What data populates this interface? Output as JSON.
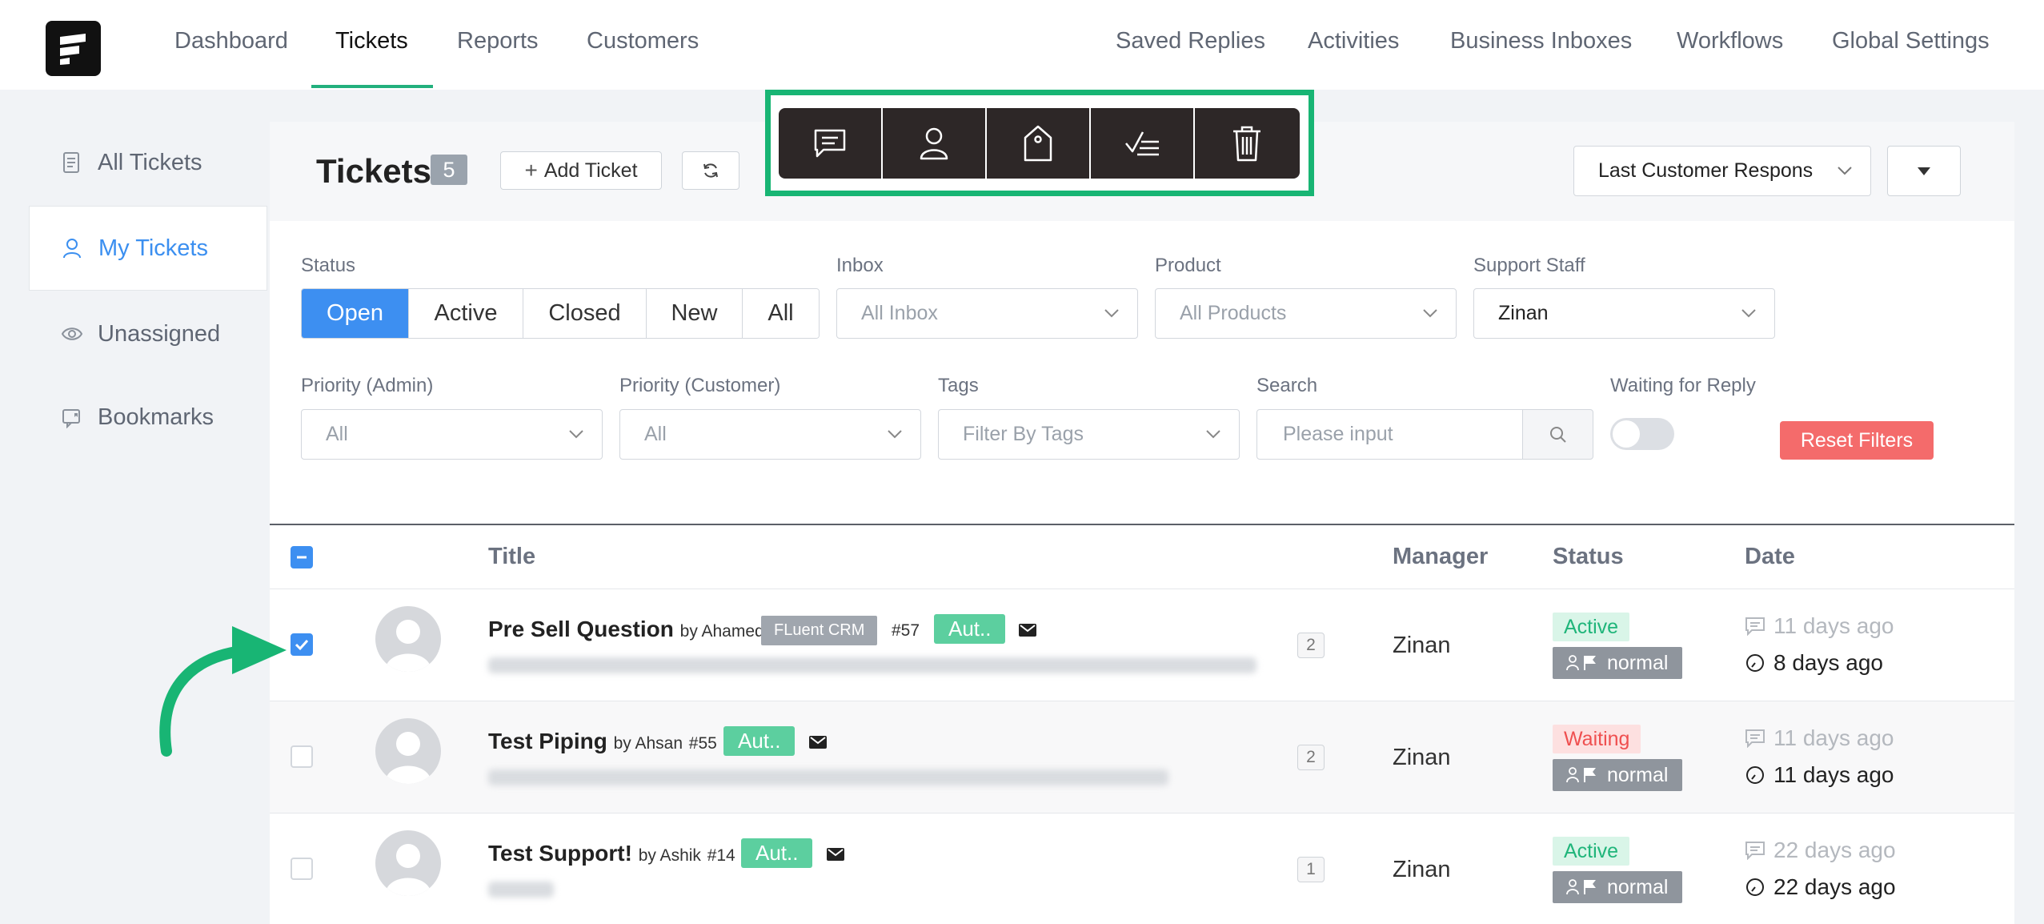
{
  "topnav": {
    "left": [
      "Dashboard",
      "Tickets",
      "Reports",
      "Customers"
    ],
    "right": [
      "Saved Replies",
      "Activities",
      "Business Inboxes",
      "Workflows",
      "Global Settings"
    ],
    "active": "Tickets"
  },
  "sidebar": {
    "items": [
      {
        "label": "All Tickets",
        "icon": "document-icon"
      },
      {
        "label": "My Tickets",
        "icon": "user-icon"
      },
      {
        "label": "Unassigned",
        "icon": "eye-icon"
      },
      {
        "label": "Bookmarks",
        "icon": "bookmark-icon"
      }
    ],
    "active": "My Tickets"
  },
  "header": {
    "title": "Tickets",
    "count": "5",
    "add_ticket_label": "Add Ticket",
    "sort_select": "Last Customer Respons"
  },
  "bulk_actions": [
    "reply-icon",
    "assign-user-icon",
    "tag-icon",
    "status-check-icon",
    "trash-icon"
  ],
  "filters": {
    "status_label": "Status",
    "status_options": [
      "Open",
      "Active",
      "Closed",
      "New",
      "All"
    ],
    "status_selected": "Open",
    "inbox_label": "Inbox",
    "inbox_placeholder": "All Inbox",
    "product_label": "Product",
    "product_placeholder": "All Products",
    "staff_label": "Support Staff",
    "staff_value": "Zinan",
    "priority_admin_label": "Priority (Admin)",
    "priority_admin_value": "All",
    "priority_customer_label": "Priority (Customer)",
    "priority_customer_value": "All",
    "tags_label": "Tags",
    "tags_placeholder": "Filter By Tags",
    "search_label": "Search",
    "search_placeholder": "Please input",
    "waiting_label": "Waiting for Reply",
    "reset_label": "Reset Filters"
  },
  "table": {
    "columns": [
      "Title",
      "Manager",
      "Status",
      "Date"
    ],
    "rows": [
      {
        "title": "Pre Sell Question",
        "by": "by Ahamed",
        "product_tag": "FLuent CRM",
        "id": "#57",
        "auto_tag": "Aut..",
        "count": "2",
        "manager": "Zinan",
        "status": "Active",
        "priority": "normal",
        "date_response": "11 days ago",
        "date_created": "8 days ago",
        "checked": true
      },
      {
        "title": "Test Piping",
        "by": "by Ahsan",
        "id": "#55",
        "auto_tag": "Aut..",
        "count": "2",
        "manager": "Zinan",
        "status": "Waiting",
        "priority": "normal",
        "date_response": "11 days ago",
        "date_created": "11 days ago",
        "checked": false
      },
      {
        "title": "Test Support!",
        "by": "by Ashik",
        "id": "#14",
        "auto_tag": "Aut..",
        "count": "1",
        "manager": "Zinan",
        "status": "Active",
        "priority": "normal",
        "date_response": "22 days ago",
        "date_created": "22 days ago",
        "checked": false
      }
    ]
  },
  "colors": {
    "accent_green": "#18b574",
    "primary_blue": "#3d8ff1",
    "danger_red": "#f46b6b",
    "toolbar_dark": "#2d2727"
  }
}
